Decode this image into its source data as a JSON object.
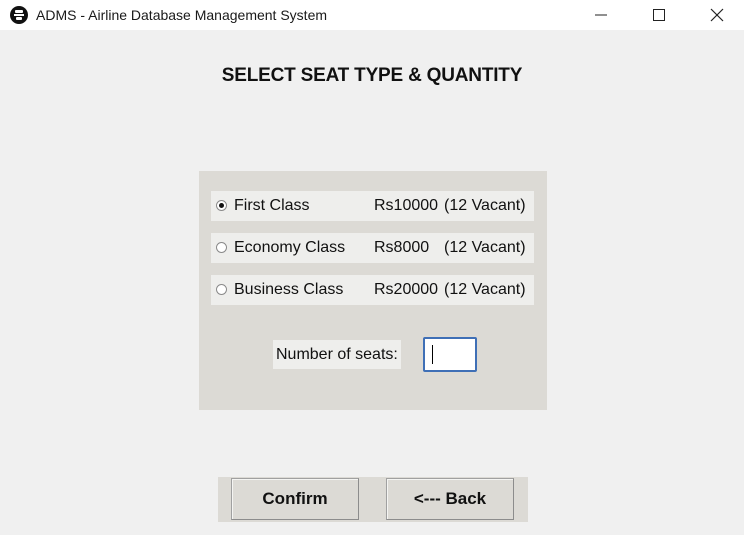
{
  "window": {
    "title": "ADMS - Airline Database Management System",
    "icons": {
      "app": "airline-app-icon",
      "minimize": "minimize-icon",
      "maximize": "maximize-icon",
      "close": "close-icon"
    }
  },
  "heading": "SELECT SEAT TYPE & QUANTITY",
  "seat_options": [
    {
      "name": "First Class",
      "price": "Rs10000",
      "vacant": "(12 Vacant)",
      "selected": true
    },
    {
      "name": "Economy Class",
      "price": "Rs8000",
      "vacant": "(12 Vacant)",
      "selected": false
    },
    {
      "name": "Business Class",
      "price": "Rs20000",
      "vacant": "(12 Vacant)",
      "selected": false
    }
  ],
  "quantity": {
    "label": "Number of seats:",
    "value": ""
  },
  "buttons": {
    "confirm": "Confirm",
    "back": "<--- Back"
  },
  "colors": {
    "window_bg": "#f0f0f0",
    "panel_bg": "#dcdad5",
    "row_bg": "#eeeeec",
    "input_border": "#3f6fb6"
  }
}
